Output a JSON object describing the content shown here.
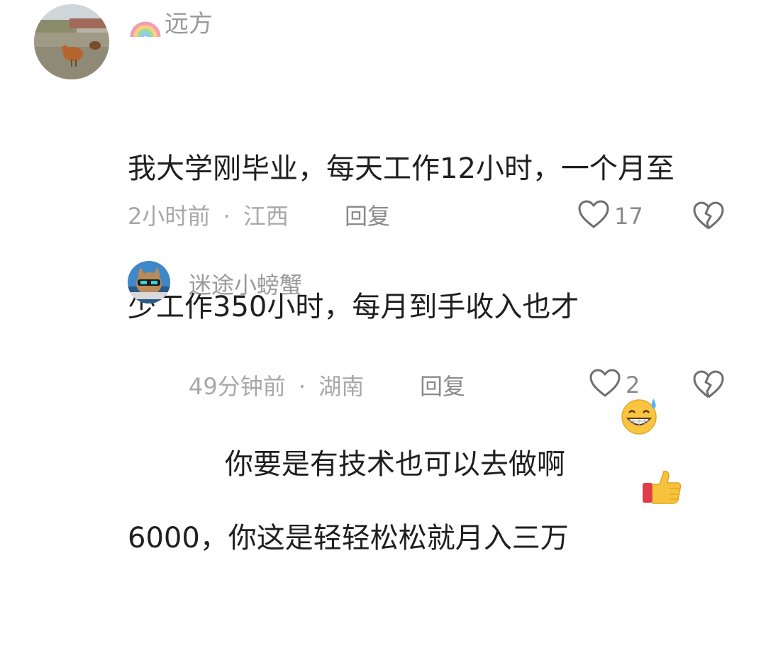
{
  "comments": [
    {
      "username": "远方",
      "badge_icon": "rainbow-icon",
      "text_lines": [
        "我大学刚毕业，每天工作12小时，一个月至",
        "少工作350小时，每月到手收入也才",
        "6000，你这是轻轻松松就月入三万"
      ],
      "trailing_emoji": "thumbs-up-emoji",
      "time": "2小时前",
      "separator": "·",
      "location": "江西",
      "reply_label": "回复",
      "like_count": "17"
    },
    {
      "username": "迷途小螃蟹",
      "text": "你要是有技术也可以去做啊",
      "trailing_emoji": "grinning-sweat-emoji",
      "time": "49分钟前",
      "separator": "·",
      "location": "湖南",
      "reply_label": "回复",
      "like_count": "2"
    }
  ],
  "icons": {
    "like": "heart-outline-icon",
    "dislike": "broken-heart-outline-icon"
  },
  "colors": {
    "text": "#1f1f1f",
    "username": "#9a9a9a",
    "meta": "#a8a8a8",
    "icon": "#6f6f6f"
  }
}
